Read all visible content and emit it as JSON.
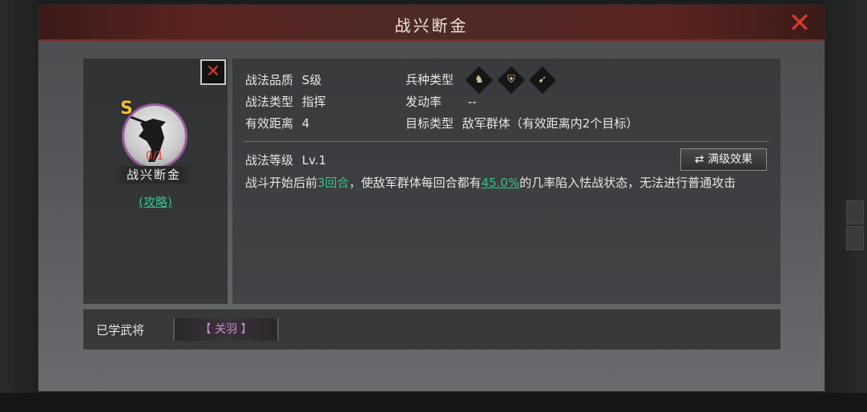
{
  "dialog": {
    "title": "战兴断金",
    "close_glyph": "✕"
  },
  "skill_card": {
    "grade": "S",
    "count": "0/1",
    "name": "战兴断金",
    "strategy_link": "(攻略)",
    "close_glyph": "✕"
  },
  "details": {
    "quality_label": "战法品质",
    "quality_value": "S级",
    "type_label": "战法类型",
    "type_value": "指挥",
    "range_label": "有效距离",
    "range_value": "4",
    "troop_label": "兵种类型",
    "troop_icons": [
      "horse-icon",
      "shield-icon",
      "bow-icon"
    ],
    "rate_label": "发动率",
    "rate_value": "--",
    "target_label": "目标类型",
    "target_value": "敌军群体（有效距离内2个目标）",
    "level_label": "战法等级",
    "level_value": "Lv.1",
    "max_level_button": "满级效果",
    "desc_part1": "战斗开始后前",
    "desc_hl1": "3回合",
    "desc_part2": "，使敌军群体每回合都有",
    "desc_hl2": "45.0%",
    "desc_part3": "的几率陷入怯战状态，无法进行普通攻击"
  },
  "learned": {
    "label": "已学武将",
    "general": "【 关羽 】"
  },
  "colors": {
    "accent_green": "#34c28a",
    "close_red": "#d63a2c",
    "grade_gold": "#f2c032",
    "general_purple": "#c98fd0"
  }
}
